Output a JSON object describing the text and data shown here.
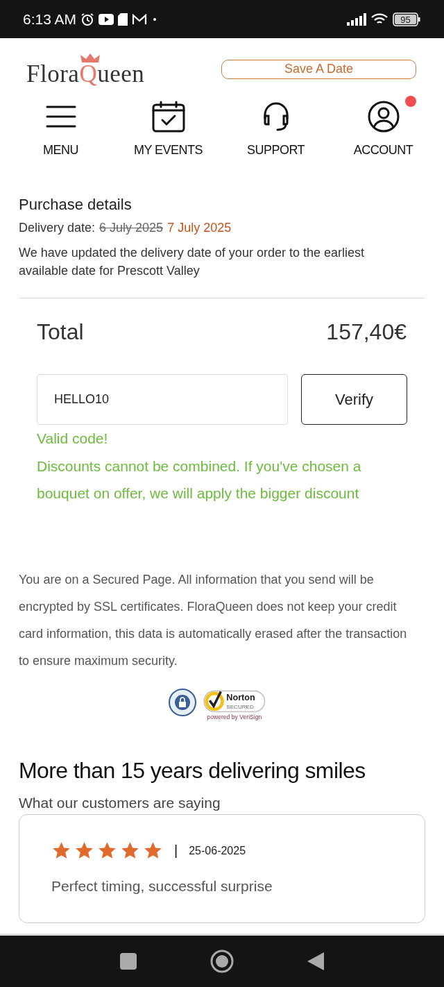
{
  "status_bar": {
    "time": "6:13 AM",
    "battery": "95"
  },
  "header": {
    "logo": {
      "before": "Flora",
      "accent": "Q",
      "after": "ueen"
    },
    "save_button": "Save A Date"
  },
  "nav": [
    {
      "kind": "menu",
      "label": "MENU",
      "notification": false
    },
    {
      "kind": "events",
      "label": "MY EVENTS",
      "notification": false
    },
    {
      "kind": "support",
      "label": "SUPPORT",
      "notification": false
    },
    {
      "kind": "account",
      "label": "ACCOUNT",
      "notification": true
    }
  ],
  "purchase": {
    "title": "Purchase details",
    "delivery_label": "Delivery date:",
    "old_date": "6 July 2025",
    "new_date": "7 July 2025",
    "notice": "We have updated the delivery date of your order to the earliest available date for Prescott Valley"
  },
  "total": {
    "label": "Total",
    "amount": "157,40€"
  },
  "discount": {
    "value": "HELLO10",
    "button": "Verify",
    "valid": true,
    "status": "Valid code!",
    "message": "Discounts cannot be combined. If you've chosen a bouquet on offer, we will apply the bigger discount"
  },
  "security": {
    "text": "You are on a Secured Page. All information that you send will be encrypted by SSL certificates. FloraQueen does not keep your credit card information, this data is automatically erased after the transaction to ensure maximum security.",
    "norton_name": "Norton",
    "norton_secured": "SECURED",
    "norton_powered": "powered by VeriSign"
  },
  "reviews": {
    "heading": "More than 15 years delivering smiles",
    "subheading": "What our customers are saying",
    "items": [
      {
        "stars": 5,
        "separator": "|",
        "date": "25-06-2025",
        "text": "Perfect timing, successful surprise"
      }
    ]
  }
}
